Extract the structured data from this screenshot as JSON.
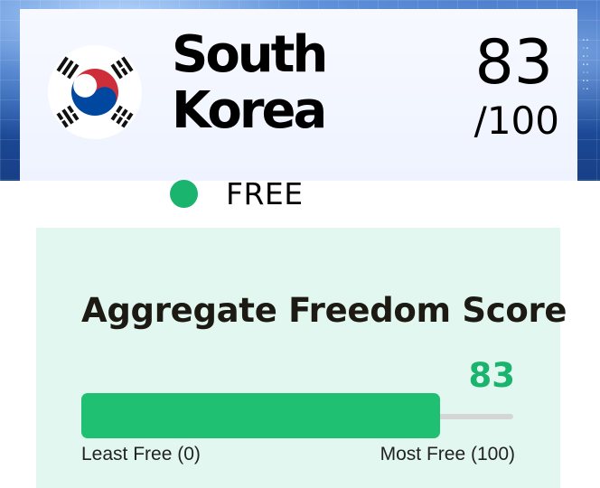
{
  "country": {
    "name_line1": "South",
    "name_line2": "Korea",
    "score": "83",
    "score_out_of": "/100",
    "status": "FREE",
    "flag_icon": "south-korea-flag-icon"
  },
  "aggregate": {
    "title": "Aggregate Freedom Score",
    "score": "83",
    "score_fraction": 0.83,
    "min_label": "Least Free (0)",
    "max_label": "Most Free (100)"
  },
  "colors": {
    "free_green": "#1ab46e",
    "bar_green": "#1fc072",
    "panel_bg": "#e2f7ef",
    "flag_red": "#cd2e3a",
    "flag_blue": "#0047a0"
  }
}
